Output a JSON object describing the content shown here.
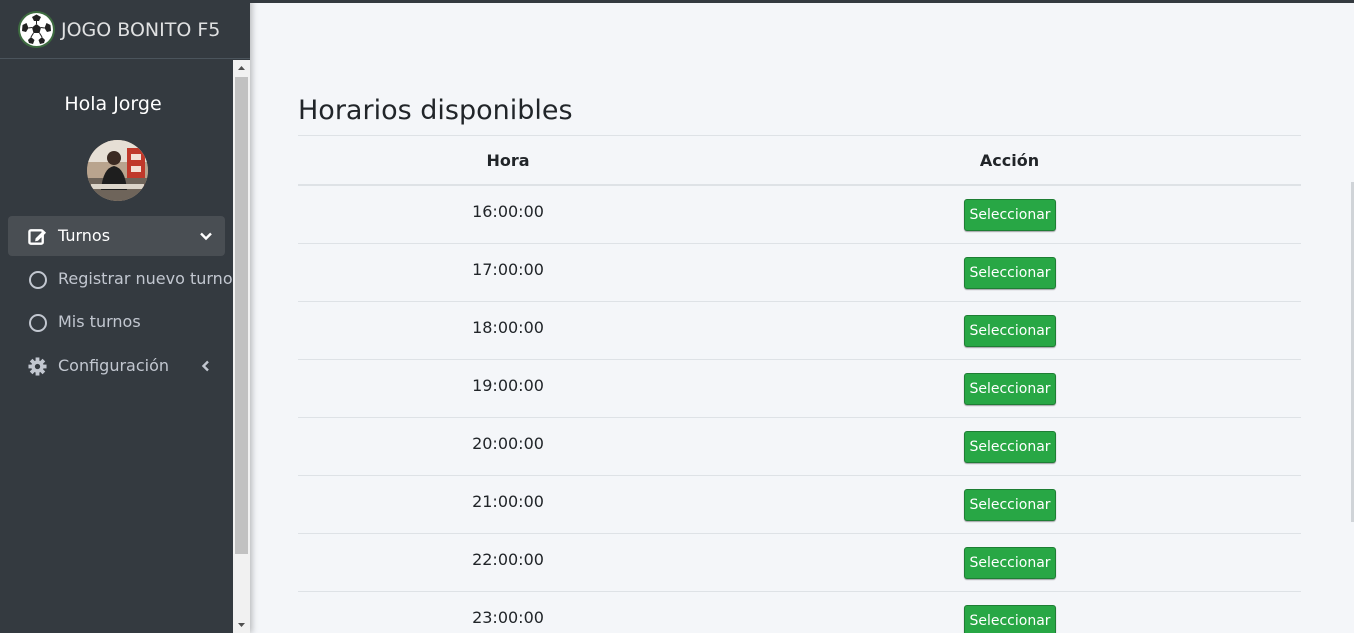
{
  "brand": {
    "name": "JOGO BONITO F5",
    "logo_icon": "soccer-ball-icon"
  },
  "user": {
    "greeting": "Hola Jorge",
    "avatar_icon": "user-avatar"
  },
  "nav": {
    "turnos": {
      "label": "Turnos",
      "icon": "edit-icon",
      "arrow": "chevron-down-icon",
      "active": true
    },
    "registrar": {
      "label": "Registrar nuevo turno",
      "icon": "circle-icon"
    },
    "mis_turnos": {
      "label": "Mis turnos",
      "icon": "circle-icon"
    },
    "configuracion": {
      "label": "Configuración",
      "icon": "gear-icon",
      "arrow": "chevron-left-icon"
    }
  },
  "main": {
    "title": "Horarios disponibles",
    "table": {
      "headers": [
        "Hora",
        "Acción"
      ],
      "button_label": "Seleccionar",
      "rows": [
        {
          "hora": "16:00:00"
        },
        {
          "hora": "17:00:00"
        },
        {
          "hora": "18:00:00"
        },
        {
          "hora": "19:00:00"
        },
        {
          "hora": "20:00:00"
        },
        {
          "hora": "21:00:00"
        },
        {
          "hora": "22:00:00"
        },
        {
          "hora": "23:00:00"
        }
      ]
    }
  },
  "colors": {
    "sidebar": "#343a40",
    "button": "#28a745",
    "background": "#f4f6f9"
  }
}
